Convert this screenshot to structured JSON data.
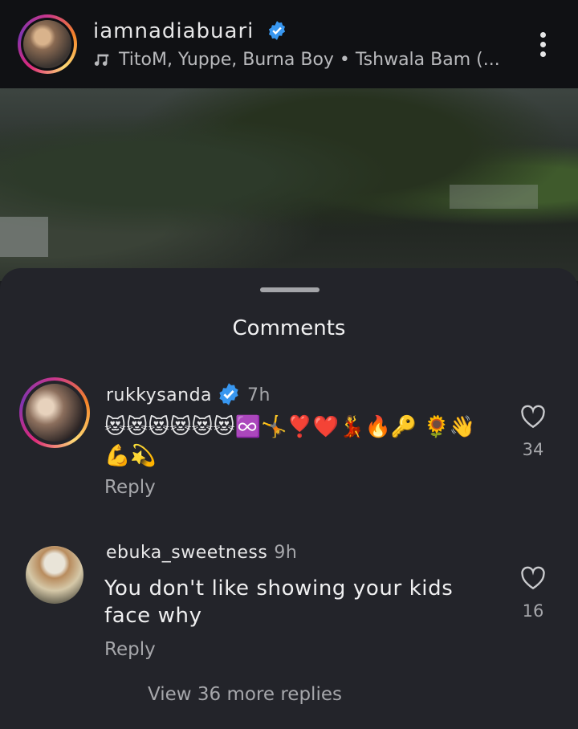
{
  "post": {
    "username": "iamnadiabuari",
    "music": "TitoM, Yuppe, Burna Boy • Tshwala Bam (..."
  },
  "comments_sheet": {
    "title": "Comments",
    "comments": [
      {
        "username": "rukkysanda",
        "time": "7h",
        "text": "😻😻😻😻😻😻♾️🤸❣️❤️💃🔥🔑 🌻👋💪💫",
        "reply_label": "Reply",
        "likes": "34"
      },
      {
        "username": "ebuka_sweetness",
        "time": "9h",
        "text": "You don't like showing your kids face why",
        "reply_label": "Reply",
        "likes": "16"
      }
    ],
    "view_more": "View 36 more replies"
  },
  "colors": {
    "verified_blue": "#3897f0",
    "sheet_bg": "#23242a",
    "muted_text": "#a6a7ab"
  }
}
